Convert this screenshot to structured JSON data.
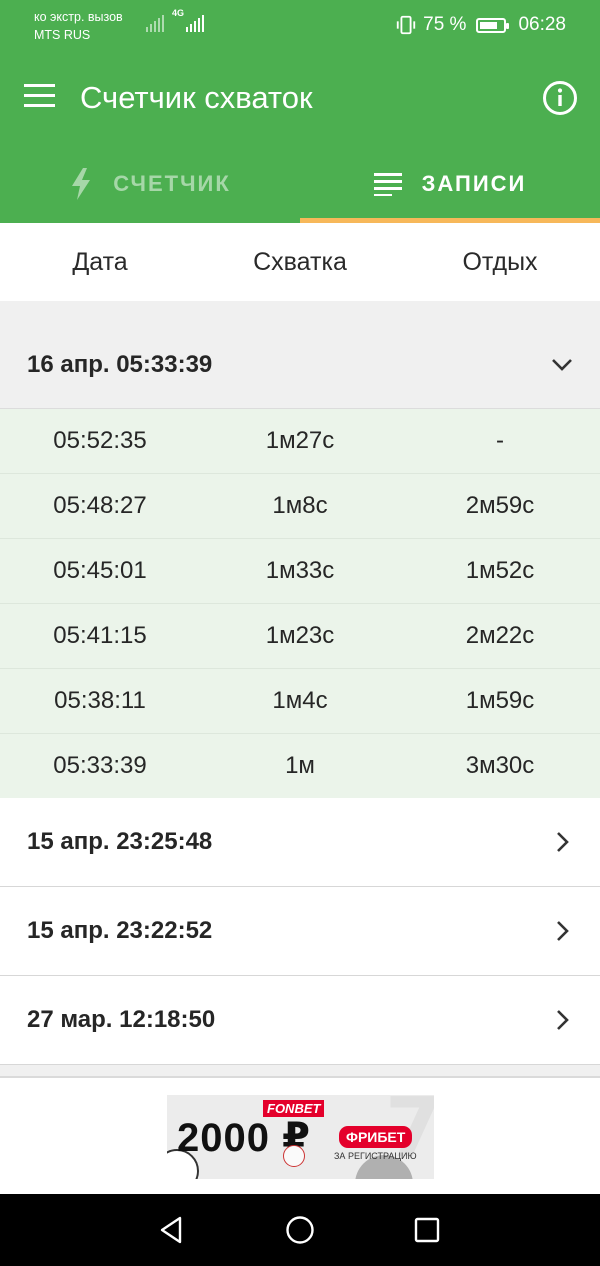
{
  "status_bar": {
    "carrier_line1": "ко экстр. вызов",
    "carrier_line2": "MTS RUS",
    "network": "4G",
    "battery_text": "75 %",
    "battery_level": 0.75,
    "time": "06:28"
  },
  "app_bar": {
    "title": "Счетчик схваток",
    "menu_icon": "menu-icon",
    "info_icon": "info-icon"
  },
  "tabs": [
    {
      "label": "СЧЕТЧИК",
      "icon": "lightning-icon",
      "active": false
    },
    {
      "label": "ЗАПИСИ",
      "icon": "list-icon",
      "active": true
    }
  ],
  "columns": [
    "Дата",
    "Схватка",
    "Отдых"
  ],
  "sessions": [
    {
      "title": "16 апр. 05:33:39",
      "expanded": true,
      "rows": [
        [
          "05:52:35",
          "1м27с",
          "-"
        ],
        [
          "05:48:27",
          "1м8с",
          "2м59с"
        ],
        [
          "05:45:01",
          "1м33с",
          "1м52с"
        ],
        [
          "05:41:15",
          "1м23с",
          "2м22с"
        ],
        [
          "05:38:11",
          "1м4с",
          "1м59с"
        ],
        [
          "05:33:39",
          "1м",
          "3м30с"
        ]
      ]
    },
    {
      "title": "15 апр. 23:25:48",
      "expanded": false
    },
    {
      "title": "15 апр. 23:22:52",
      "expanded": false
    },
    {
      "title": "27 мар. 12:18:50",
      "expanded": false
    }
  ],
  "ad": {
    "brand": "FONBET",
    "amount": "2000 ₽",
    "badge": "ФРИБЕТ",
    "subtext": "ЗА РЕГИСТРАЦИЮ"
  },
  "colors": {
    "primary": "#4caf50",
    "tab_indicator": "#f7b85a",
    "expanded_row_bg": "#ebf4ea",
    "ad_red": "#e4002b"
  }
}
